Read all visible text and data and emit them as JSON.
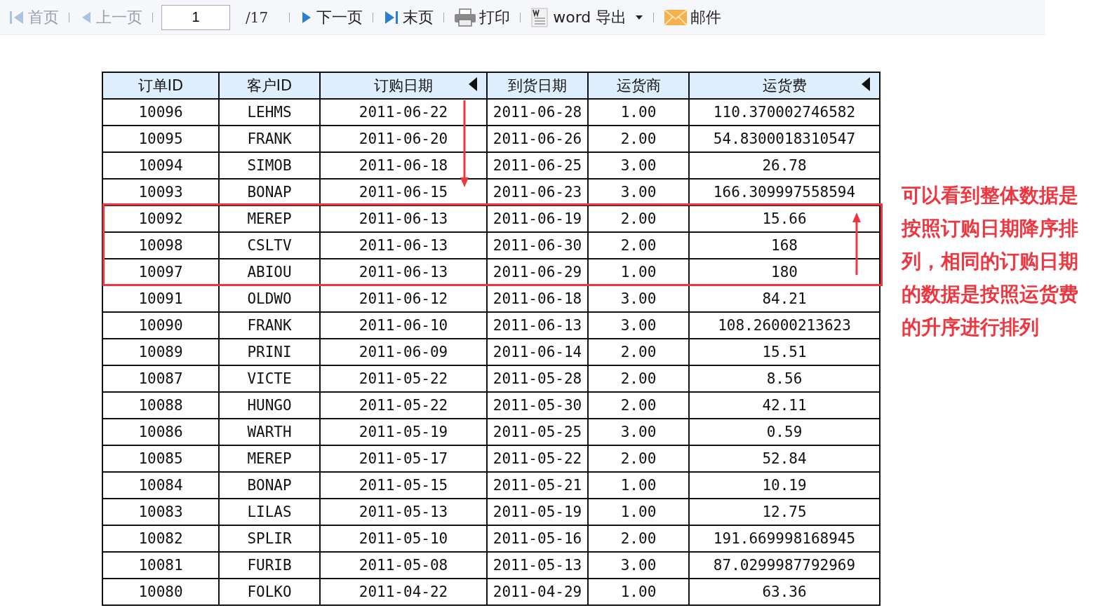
{
  "toolbar": {
    "first_page": {
      "label": "首页",
      "disabled": true
    },
    "prev_page": {
      "label": "上一页",
      "disabled": true
    },
    "page_input": {
      "value": "1"
    },
    "page_total": "/17",
    "next_page": {
      "label": "下一页",
      "disabled": false
    },
    "last_page": {
      "label": "末页",
      "disabled": false
    },
    "print": {
      "label": "打印"
    },
    "word_export": {
      "label": "word 导出"
    },
    "mail": {
      "label": "邮件"
    }
  },
  "table": {
    "columns": [
      {
        "label": "订单ID",
        "sorted": false
      },
      {
        "label": "客户ID",
        "sorted": false
      },
      {
        "label": "订购日期",
        "sorted": true
      },
      {
        "label": "到货日期",
        "sorted": false
      },
      {
        "label": "运货商",
        "sorted": false
      },
      {
        "label": "运货费",
        "sorted": true
      }
    ],
    "rows": [
      {
        "highlighted": false,
        "cells": [
          "10096",
          "LEHMS",
          "2011-06-22",
          "2011-06-28",
          "1.00",
          "110.370002746582"
        ]
      },
      {
        "highlighted": false,
        "cells": [
          "10095",
          "FRANK",
          "2011-06-20",
          "2011-06-26",
          "2.00",
          "54.8300018310547"
        ]
      },
      {
        "highlighted": false,
        "cells": [
          "10094",
          "SIMOB",
          "2011-06-18",
          "2011-06-25",
          "3.00",
          "26.78"
        ]
      },
      {
        "highlighted": false,
        "cells": [
          "10093",
          "BONAP",
          "2011-06-15",
          "2011-06-23",
          "3.00",
          "166.309997558594"
        ]
      },
      {
        "highlighted": true,
        "cells": [
          "10092",
          "MEREP",
          "2011-06-13",
          "2011-06-19",
          "2.00",
          "15.66"
        ]
      },
      {
        "highlighted": true,
        "cells": [
          "10098",
          "CSLTV",
          "2011-06-13",
          "2011-06-30",
          "2.00",
          "168"
        ]
      },
      {
        "highlighted": true,
        "cells": [
          "10097",
          "ABIOU",
          "2011-06-13",
          "2011-06-29",
          "1.00",
          "180"
        ]
      },
      {
        "highlighted": false,
        "cells": [
          "10091",
          "OLDWO",
          "2011-06-12",
          "2011-06-18",
          "3.00",
          "84.21"
        ]
      },
      {
        "highlighted": false,
        "cells": [
          "10090",
          "FRANK",
          "2011-06-10",
          "2011-06-13",
          "3.00",
          "108.26000213623"
        ]
      },
      {
        "highlighted": false,
        "cells": [
          "10089",
          "PRINI",
          "2011-06-09",
          "2011-06-14",
          "2.00",
          "15.51"
        ]
      },
      {
        "highlighted": false,
        "cells": [
          "10087",
          "VICTE",
          "2011-05-22",
          "2011-05-28",
          "2.00",
          "8.56"
        ]
      },
      {
        "highlighted": false,
        "cells": [
          "10088",
          "HUNGO",
          "2011-05-22",
          "2011-05-30",
          "2.00",
          "42.11"
        ]
      },
      {
        "highlighted": false,
        "cells": [
          "10086",
          "WARTH",
          "2011-05-19",
          "2011-05-25",
          "3.00",
          "0.59"
        ]
      },
      {
        "highlighted": false,
        "cells": [
          "10085",
          "MEREP",
          "2011-05-17",
          "2011-05-22",
          "2.00",
          "52.84"
        ]
      },
      {
        "highlighted": false,
        "cells": [
          "10084",
          "BONAP",
          "2011-05-15",
          "2011-05-21",
          "1.00",
          "10.19"
        ]
      },
      {
        "highlighted": false,
        "cells": [
          "10083",
          "LILAS",
          "2011-05-13",
          "2011-05-19",
          "1.00",
          "12.75"
        ]
      },
      {
        "highlighted": false,
        "cells": [
          "10082",
          "SPLIR",
          "2011-05-10",
          "2011-05-16",
          "2.00",
          "191.669998168945"
        ]
      },
      {
        "highlighted": false,
        "cells": [
          "10081",
          "FURIB",
          "2011-05-08",
          "2011-05-13",
          "3.00",
          "87.0299987792969"
        ]
      },
      {
        "highlighted": false,
        "cells": [
          "10080",
          "FOLKO",
          "2011-04-22",
          "2011-04-29",
          "1.00",
          "63.36"
        ]
      }
    ]
  },
  "annotation": "可以看到整体数据是按照订购日期降序排列，相同的订购日期的数据是按照运货费的升序进行排列"
}
